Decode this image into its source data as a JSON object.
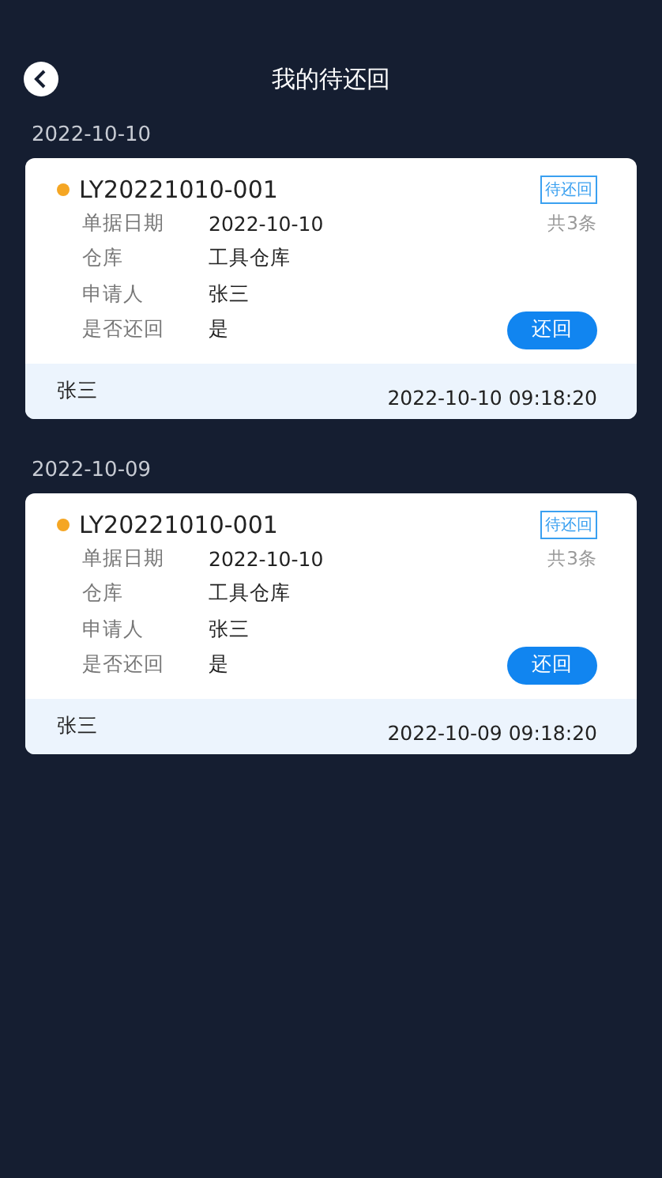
{
  "header": {
    "title": "我的待还回"
  },
  "groups": [
    {
      "date": "2022-10-10",
      "card": {
        "code": "LY20221010-001",
        "status": "待还回",
        "count": "共3条",
        "fields": [
          {
            "label": "单据日期",
            "value": "2022-10-10"
          },
          {
            "label": "仓库",
            "value": "工具仓库"
          },
          {
            "label": "申请人",
            "value": "张三"
          },
          {
            "label": "是否还回",
            "value": "是"
          }
        ],
        "action": "还回",
        "footer_name": "张三",
        "footer_time": "2022-10-10 09:18:20"
      }
    },
    {
      "date": "2022-10-09",
      "card": {
        "code": "LY20221010-001",
        "status": "待还回",
        "count": "共3条",
        "fields": [
          {
            "label": "单据日期",
            "value": "2022-10-10"
          },
          {
            "label": "仓库",
            "value": "工具仓库"
          },
          {
            "label": "申请人",
            "value": "张三"
          },
          {
            "label": "是否还回",
            "value": "是"
          }
        ],
        "action": "还回",
        "footer_name": "张三",
        "footer_time": "2022-10-09 09:18:20"
      }
    }
  ]
}
